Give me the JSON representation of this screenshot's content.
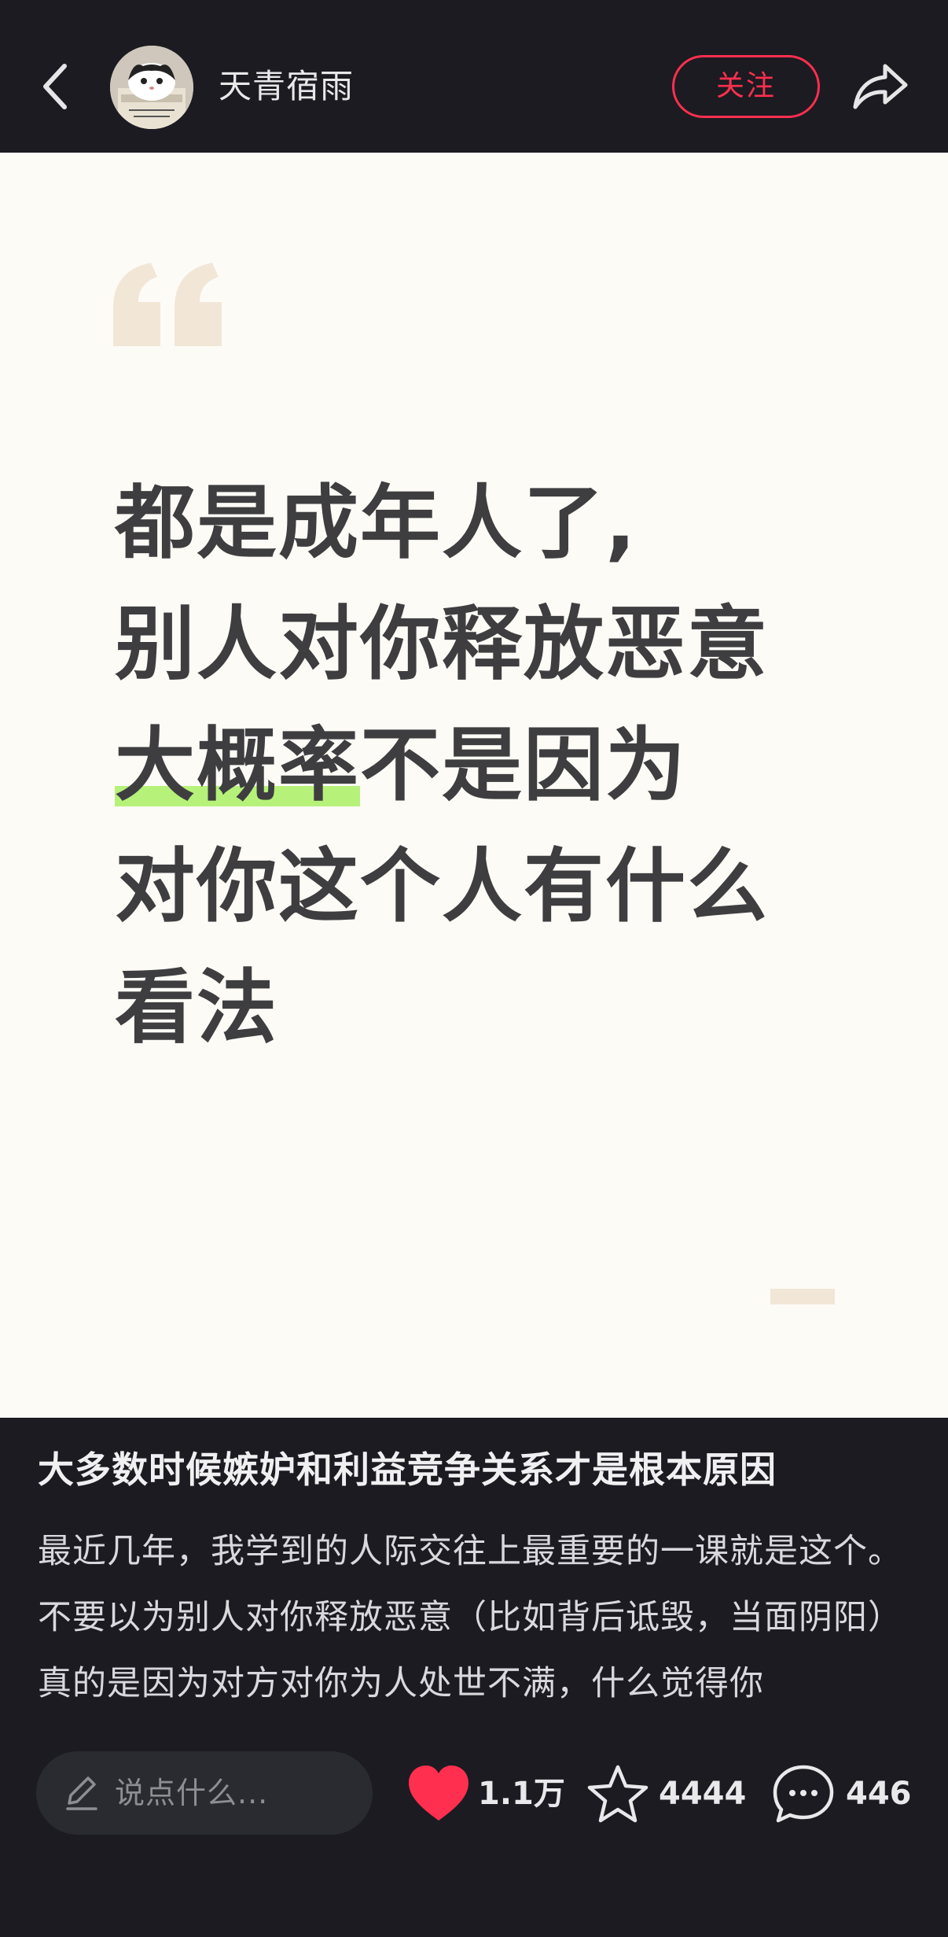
{
  "header": {
    "username": "天青宿雨",
    "follow_label": "关注"
  },
  "post": {
    "quote_lines": [
      {
        "highlight": "",
        "text": "都是成年人了,"
      },
      {
        "highlight": "",
        "text": "别人对你释放恶意"
      },
      {
        "highlight": "大概率",
        "text": "不是因为"
      },
      {
        "highlight": "",
        "text": "对你这个人有什么"
      },
      {
        "highlight": "",
        "text": "看法"
      }
    ],
    "title": "大多数时候嫉妒和利益竞争关系才是根本原因",
    "body_paragraphs": [
      "最近几年，我学到的人际交往上最重要的一课就是这个。",
      "不要以为别人对你释放恶意（比如背后诋毁，当面阴阳）真的是因为对方对你为人处世不满，什么觉得你"
    ]
  },
  "bottom_bar": {
    "comment_placeholder": "说点什么...",
    "likes": "1.1万",
    "favorites": "4444",
    "comments": "446"
  },
  "colors": {
    "accent": "#ff2f4f",
    "highlight": "#b6f27a",
    "card_background": "#fdfbf6",
    "app_background": "#1b1b21"
  },
  "icons": [
    "back-icon",
    "avatar",
    "share-icon",
    "quote-icon",
    "pen-icon",
    "heart-icon",
    "star-icon",
    "comment-icon"
  ]
}
